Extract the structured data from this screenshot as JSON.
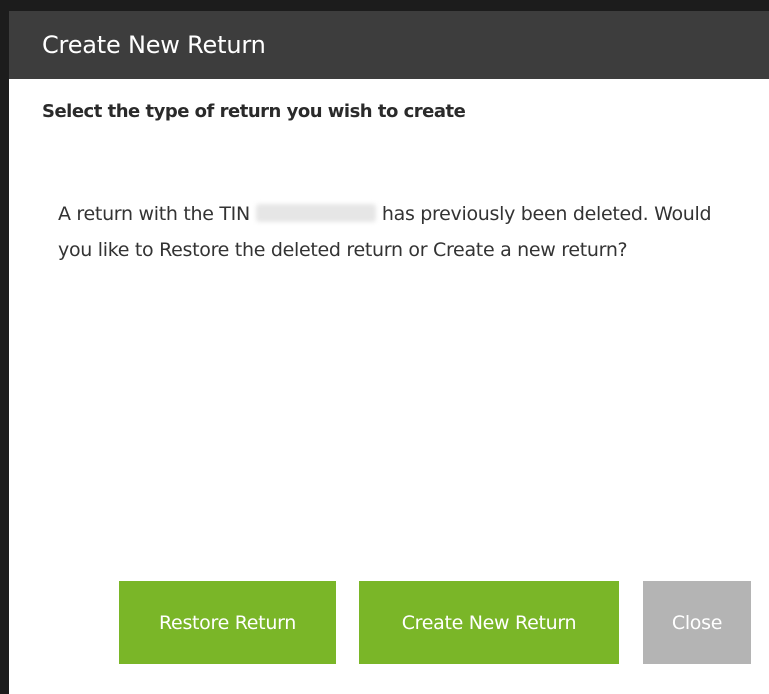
{
  "dialog": {
    "title": "Create New Return",
    "subheading": "Select the type of return you wish to create",
    "message": {
      "before_tin": "A return with the TIN",
      "after_tin": "has previously been deleted. Would you like to Restore the deleted return or Create a new return?"
    },
    "buttons": {
      "restore_label": "Restore Return",
      "create_label": "Create New Return",
      "close_label": "Close"
    }
  },
  "colors": {
    "title_bar": "#3d3d3d",
    "primary_button": "#7ab628",
    "secondary_button": "#b4b4b4"
  }
}
